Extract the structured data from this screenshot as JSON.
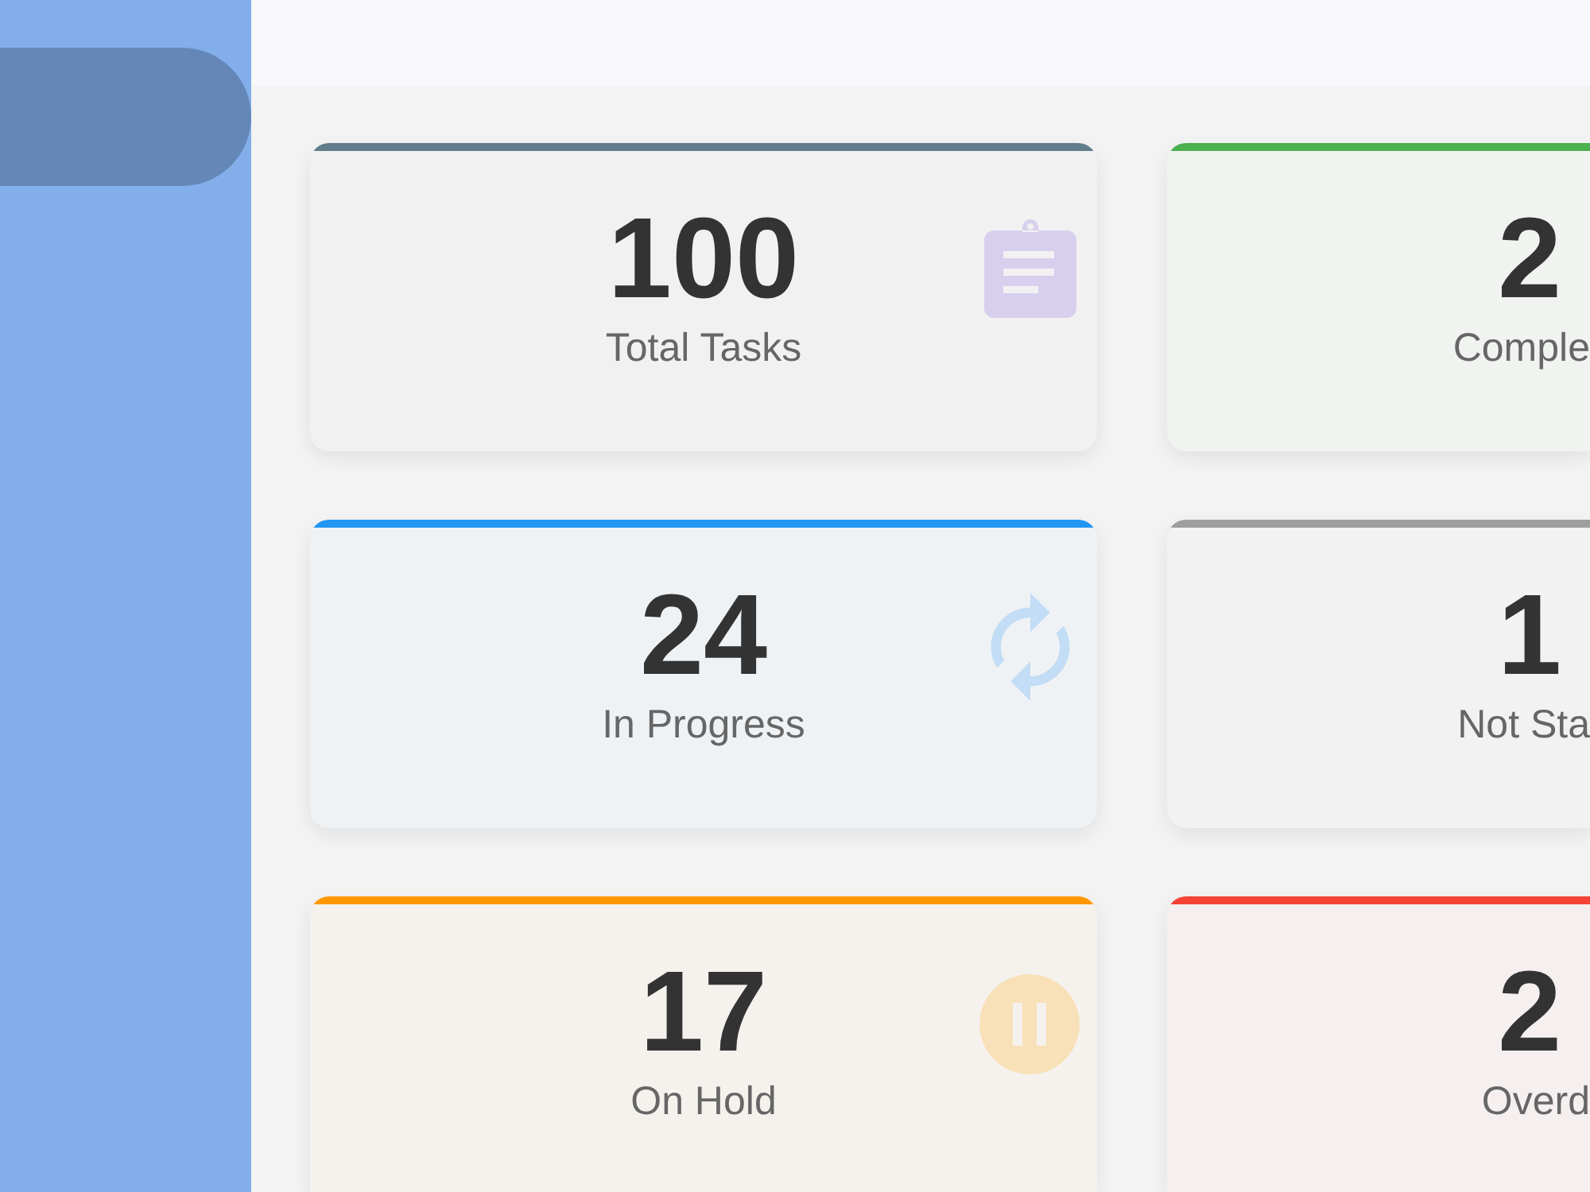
{
  "sidebar": {
    "items": [
      {
        "selected": true
      }
    ]
  },
  "cards": [
    {
      "value": "100",
      "label": "Total Tasks",
      "color": "#607d8b"
    },
    {
      "value": "2",
      "label": "Comple",
      "color": "#4caf50"
    },
    {
      "value": "24",
      "label": "In Progress",
      "color": "#2196f3"
    },
    {
      "value": "1",
      "label": "Not Sta",
      "color": "#9e9e9e"
    },
    {
      "value": "17",
      "label": "On Hold",
      "color": "#ff9800"
    },
    {
      "value": "2",
      "label": "Overd",
      "color": "#f44336"
    }
  ]
}
